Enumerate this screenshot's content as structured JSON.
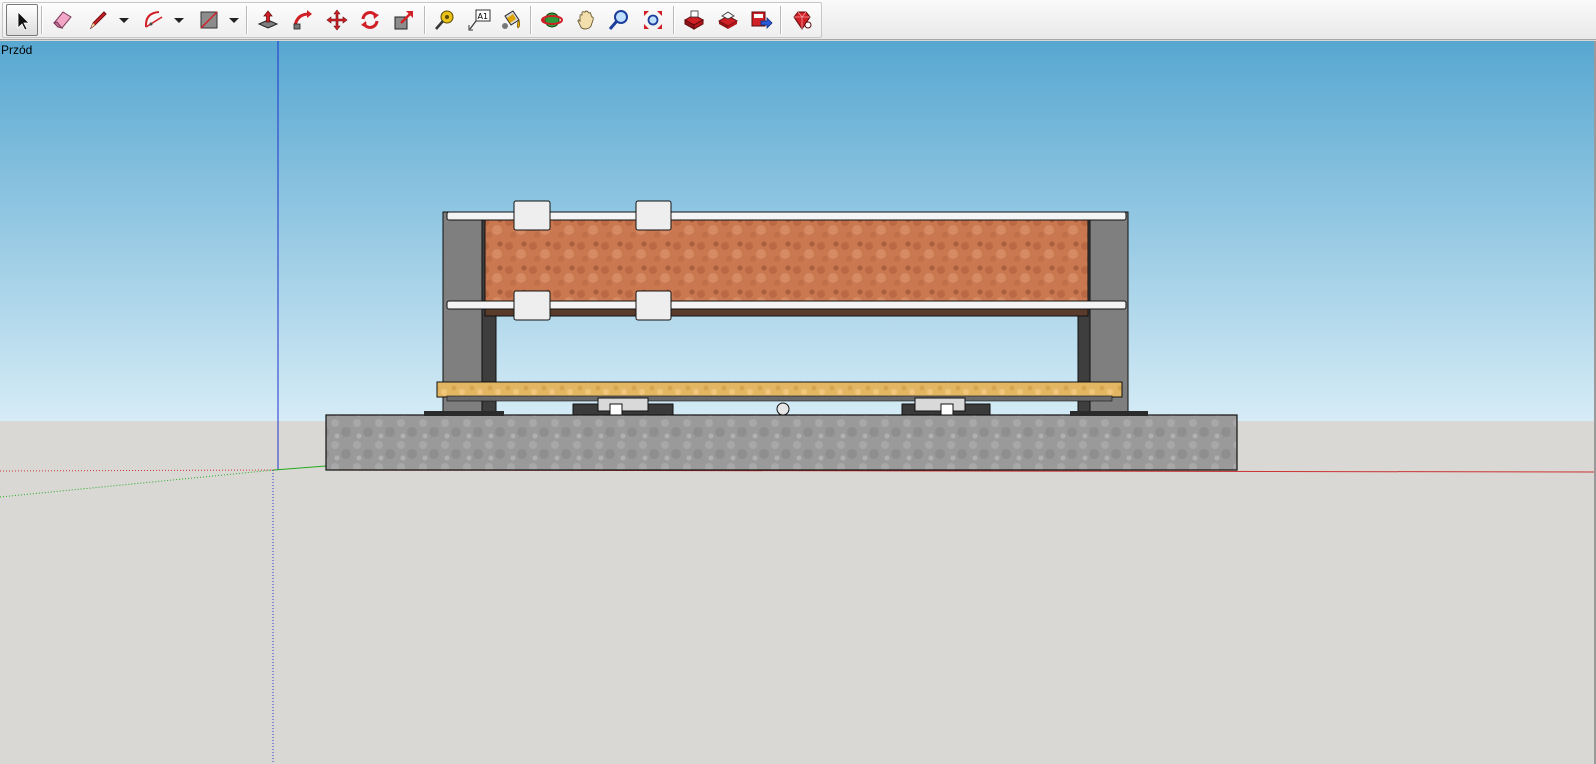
{
  "view_label": "Przód",
  "colors": {
    "sky_top": "#57a7d1",
    "sky_bottom": "#d6ecf6",
    "ground": "#d9d8d4",
    "red_axis": "#cc3333",
    "green_axis": "#22aa22",
    "blue_axis": "#2233cc",
    "tool_red": "#d11f26"
  },
  "toolbar": {
    "tools": [
      {
        "name": "select-tool",
        "icon": "cursor-arrow-icon",
        "active": true
      },
      {
        "name": "eraser-tool",
        "icon": "eraser-icon"
      },
      {
        "name": "pencil-tool",
        "icon": "pencil-icon",
        "dropdown": true
      },
      {
        "name": "arc-tool",
        "icon": "arc-icon",
        "dropdown": true
      },
      {
        "name": "rectangle-tool",
        "icon": "rectangle-icon",
        "dropdown": true
      },
      {
        "name": "push-pull-tool",
        "icon": "push-pull-icon"
      },
      {
        "name": "follow-me-tool",
        "icon": "follow-me-icon"
      },
      {
        "name": "move-tool",
        "icon": "move-icon"
      },
      {
        "name": "rotate-tool",
        "icon": "rotate-icon"
      },
      {
        "name": "scale-tool",
        "icon": "scale-icon"
      },
      {
        "name": "tape-measure-tool",
        "icon": "tape-measure-icon"
      },
      {
        "name": "text-tool",
        "icon": "text-label-icon",
        "label": "A1"
      },
      {
        "name": "paint-bucket-tool",
        "icon": "paint-bucket-icon"
      },
      {
        "name": "orbit-tool",
        "icon": "orbit-icon"
      },
      {
        "name": "pan-tool",
        "icon": "hand-icon"
      },
      {
        "name": "zoom-tool",
        "icon": "magnifier-icon"
      },
      {
        "name": "zoom-extents-tool",
        "icon": "zoom-extents-icon"
      },
      {
        "name": "warehouse-tool",
        "icon": "warehouse-icon"
      },
      {
        "name": "share-component-tool",
        "icon": "share-component-icon"
      },
      {
        "name": "share-model-tool",
        "icon": "share-model-icon"
      },
      {
        "name": "ruby-console-tool",
        "icon": "ruby-gem-icon"
      }
    ]
  }
}
